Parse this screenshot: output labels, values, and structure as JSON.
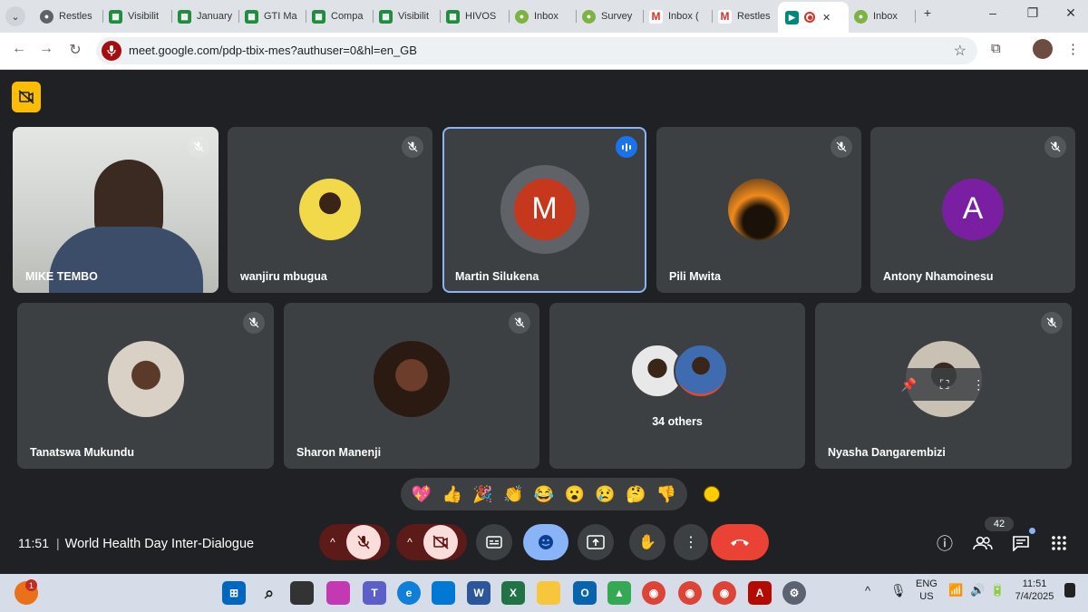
{
  "browser": {
    "tabs": [
      {
        "label": "Restles",
        "icon": "globe-icon"
      },
      {
        "label": "Visibilit",
        "icon": "sheets-icon"
      },
      {
        "label": "January",
        "icon": "sheets-icon"
      },
      {
        "label": "GTI Ma",
        "icon": "sheets-icon"
      },
      {
        "label": "Compa",
        "icon": "sheets-icon"
      },
      {
        "label": "Visibilit",
        "icon": "sheets-icon"
      },
      {
        "label": "HIVOS",
        "icon": "sheets-icon"
      },
      {
        "label": "Inbox",
        "icon": "surveycto-icon"
      },
      {
        "label": "Survey",
        "icon": "surveycto-icon"
      },
      {
        "label": "Inbox (",
        "icon": "gmail-icon"
      },
      {
        "label": "Restles",
        "icon": "gmail-icon"
      },
      {
        "label": "",
        "icon": "meet-icon"
      },
      {
        "label": "Inbox",
        "icon": "surveycto-icon"
      }
    ],
    "url": "meet.google.com/pdp-tbix-mes?authuser=0&hl=en_GB",
    "new_tab": "+",
    "minimize": "–",
    "restore": "❐",
    "close": "✕"
  },
  "meeting": {
    "participants": [
      {
        "name": "MIKE TEMBO",
        "muted": true,
        "type": "video"
      },
      {
        "name": "wanjiru mbugua",
        "muted": true,
        "type": "photo"
      },
      {
        "name": "Martin Silukena",
        "muted": false,
        "type": "letter",
        "letter": "M",
        "color": "#c5381d",
        "speaking": true
      },
      {
        "name": "Pili Mwita",
        "muted": true,
        "type": "photo"
      },
      {
        "name": "Antony Nhamoinesu",
        "muted": true,
        "type": "letter",
        "letter": "A",
        "color": "#7b1fa2"
      },
      {
        "name": "Tanatswa Mukundu",
        "muted": true,
        "type": "photo"
      },
      {
        "name": "Sharon Manenji",
        "muted": true,
        "type": "photo"
      },
      {
        "name": "34 others",
        "type": "group"
      },
      {
        "name": "Nyasha Dangarembizi",
        "muted": true,
        "type": "photo"
      }
    ],
    "reactions": [
      "💖",
      "👍",
      "🎉",
      "👏",
      "😂",
      "😮",
      "😢",
      "🤔",
      "👎"
    ],
    "time": "11:51",
    "separator": "|",
    "title": "World Health Day Inter-Dialogue",
    "participant_count": "42",
    "accent_color": "#8ab4f8",
    "end_call_color": "#ea4335"
  },
  "taskbar": {
    "notification_count": "1",
    "language": "ENG",
    "region": "US",
    "clock_time": "11:51",
    "clock_date": "7/4/2025"
  }
}
